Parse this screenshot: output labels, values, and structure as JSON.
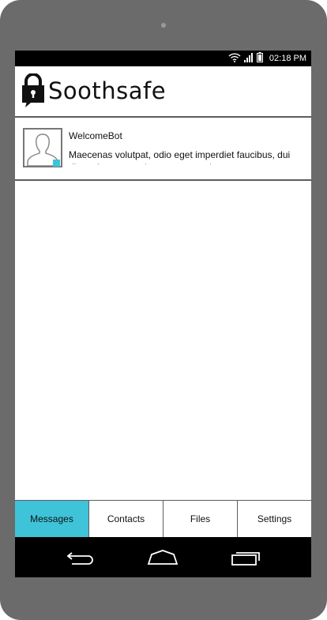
{
  "status_bar": {
    "time": "02:18 PM",
    "icons": [
      "wifi-icon",
      "signal-icon",
      "battery-icon"
    ]
  },
  "app": {
    "title": "Soothsafe",
    "logo_icon": "lock-icon"
  },
  "conversations": [
    {
      "sender": "WelcomeBot",
      "preview": "Maecenas volutpat, odio eget imperdiet faucibus, dui diam placerat turpis, non semper leo quam.",
      "avatar_icon": "person-silhouette-icon",
      "unread": true
    }
  ],
  "tabs": [
    {
      "label": "Messages",
      "active": true
    },
    {
      "label": "Contacts",
      "active": false
    },
    {
      "label": "Files",
      "active": false
    },
    {
      "label": "Settings",
      "active": false
    }
  ],
  "nav_bar": {
    "icons": [
      "back-icon",
      "home-icon",
      "recent-apps-icon"
    ]
  },
  "colors": {
    "accent": "#3fc3d9",
    "device_frame": "#6b6b6b",
    "divider": "#5d5d5d"
  }
}
